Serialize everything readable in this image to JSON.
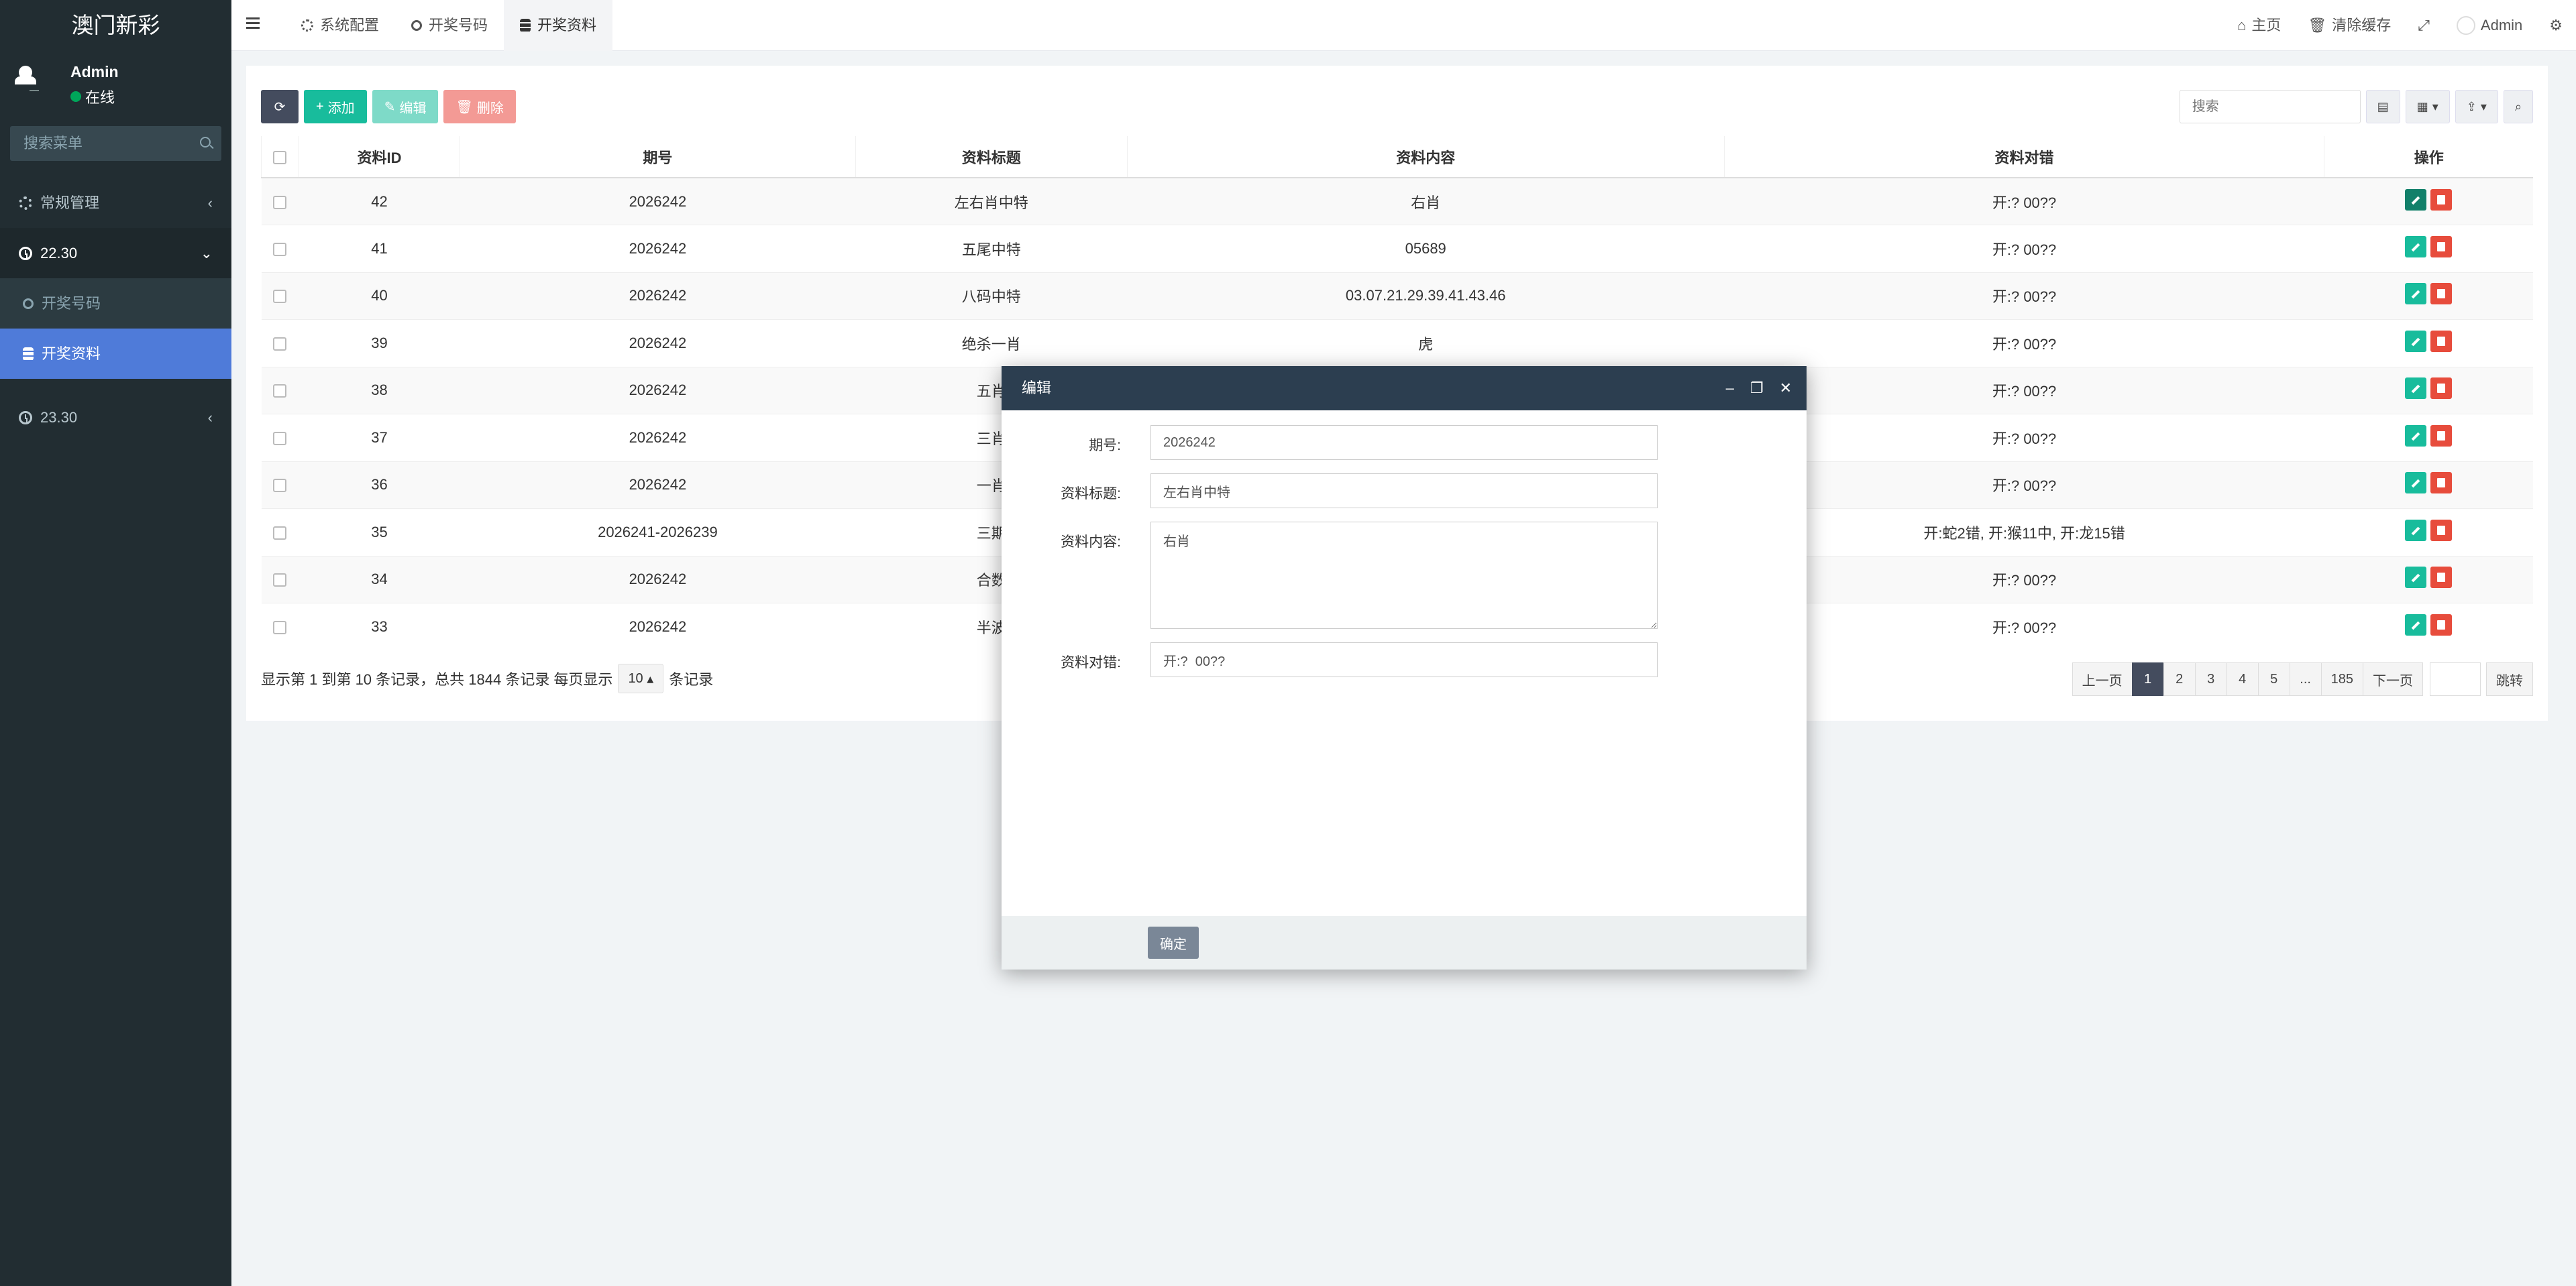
{
  "app": {
    "brand": "澳门新彩"
  },
  "user": {
    "name": "Admin",
    "status": "在线"
  },
  "sidebar": {
    "search_placeholder": "搜索菜单",
    "items": [
      {
        "label": "常规管理",
        "icon": "gears-icon"
      },
      {
        "label": "22.30",
        "icon": "clock-icon",
        "open": true
      },
      {
        "label": "开奖号码",
        "icon": "circle-icon",
        "sub": true
      },
      {
        "label": "开奖资料",
        "icon": "database-icon",
        "sub": true,
        "active": true
      },
      {
        "label": "23.30",
        "icon": "clock-icon"
      }
    ]
  },
  "topbar": {
    "tabs": [
      {
        "label": "系统配置",
        "icon": "gear-icon"
      },
      {
        "label": "开奖号码",
        "icon": "circle-icon"
      },
      {
        "label": "开奖资料",
        "icon": "database-icon",
        "active": true
      }
    ],
    "home": "主页",
    "clear_cache": "清除缓存",
    "admin": "Admin"
  },
  "toolbar": {
    "add": "添加",
    "edit": "编辑",
    "delete": "删除",
    "search_placeholder": "搜索"
  },
  "table": {
    "columns": [
      "资料ID",
      "期号",
      "资料标题",
      "资料内容",
      "资料对错",
      "操作"
    ],
    "rows": [
      {
        "id": "42",
        "issue": "2026242",
        "title": "左右肖中特",
        "content": "右肖",
        "result": "开:?  00??"
      },
      {
        "id": "41",
        "issue": "2026242",
        "title": "五尾中特",
        "content": "05689",
        "result": "开:?  00??"
      },
      {
        "id": "40",
        "issue": "2026242",
        "title": "八码中特",
        "content": "03.07.21.29.39.41.43.46",
        "result": "开:?  00??"
      },
      {
        "id": "39",
        "issue": "2026242",
        "title": "绝杀一肖",
        "content": "虎",
        "result": "开:?  00??"
      },
      {
        "id": "38",
        "issue": "2026242",
        "title": "五肖",
        "content": "",
        "result": "开:?  00??"
      },
      {
        "id": "37",
        "issue": "2026242",
        "title": "三肖",
        "content": "",
        "result": "开:?  00??"
      },
      {
        "id": "36",
        "issue": "2026242",
        "title": "一肖",
        "content": "",
        "result": "开:?  00??"
      },
      {
        "id": "35",
        "issue": "2026241-2026239",
        "title": "三期",
        "content": "",
        "result": "开:蛇2错, 开:猴11中, 开:龙15错"
      },
      {
        "id": "34",
        "issue": "2026242",
        "title": "合数",
        "content": "",
        "result": "开:?  00??"
      },
      {
        "id": "33",
        "issue": "2026242",
        "title": "半波",
        "content": "",
        "result": "开:?  00??"
      }
    ]
  },
  "footer": {
    "info_prefix": "显示第 1 到第 10 条记录，总共 1844 条记录 每页显示",
    "page_size": "10",
    "info_suffix": "条记录",
    "prev": "上一页",
    "next": "下一页",
    "pages": [
      "1",
      "2",
      "3",
      "4",
      "5",
      "...",
      "185"
    ],
    "jump": "跳转"
  },
  "modal": {
    "title": "编辑",
    "fields": [
      {
        "label": "期号:",
        "value": "2026242"
      },
      {
        "label": "资料标题:",
        "value": "左右肖中特"
      },
      {
        "label": "资料内容:",
        "value": "右肖"
      },
      {
        "label": "资料对错:",
        "value": "开:?  00??"
      }
    ],
    "ok": "确定"
  },
  "colors": {
    "sidebar_bg": "#222d32",
    "active_menu": "#4f7bd9",
    "primary_green": "#18bc9c",
    "danger_red": "#e74c3c",
    "modal_header": "#2c3e50"
  }
}
